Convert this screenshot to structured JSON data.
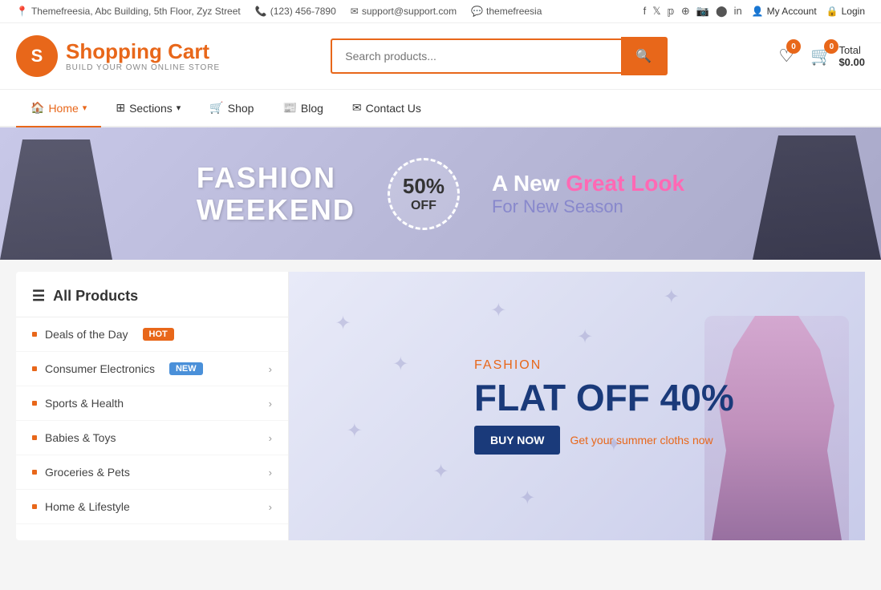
{
  "topbar": {
    "address": "Themefreesia, Abc Building, 5th Floor, Zyz Street",
    "phone": "(123) 456-7890",
    "email": "support@support.com",
    "skype": "themefreesia",
    "social_icons": [
      "facebook",
      "twitter",
      "pinterest",
      "dribbble",
      "instagram",
      "flickr",
      "linkedin"
    ],
    "my_account": "My Account",
    "login": "Login"
  },
  "header": {
    "logo_letter": "S",
    "logo_title": "Shopping Cart",
    "logo_subtitle": "BUILD YOUR OWN ONLINE STORE",
    "search_placeholder": "Search products...",
    "wishlist_count": "0",
    "cart_count": "0",
    "cart_total_label": "Total",
    "cart_total_value": "$0.00"
  },
  "nav": {
    "items": [
      {
        "label": "Home",
        "icon": "home",
        "has_dropdown": true,
        "active": true
      },
      {
        "label": "Sections",
        "icon": "grid",
        "has_dropdown": true,
        "active": false
      },
      {
        "label": "Shop",
        "icon": "cart",
        "has_dropdown": false,
        "active": false
      },
      {
        "label": "Blog",
        "icon": "blog",
        "has_dropdown": false,
        "active": false
      },
      {
        "label": "Contact Us",
        "icon": "envelope",
        "has_dropdown": false,
        "active": false
      }
    ]
  },
  "banner": {
    "text_line1": "FASHION",
    "text_line2": "WEEKEND",
    "percent": "50%",
    "off": "OFF",
    "headline_part1": "A New ",
    "headline_part2": "Great Look",
    "subheadline": "For New Season"
  },
  "sidebar": {
    "title": "All Products",
    "items": [
      {
        "label": "Deals of the Day",
        "badge": "HOT",
        "badge_type": "hot",
        "has_arrow": false
      },
      {
        "label": "Consumer Electronics",
        "badge": "NEW",
        "badge_type": "new",
        "has_arrow": true
      },
      {
        "label": "Sports & Health",
        "badge": null,
        "badge_type": null,
        "has_arrow": true
      },
      {
        "label": "Babies & Toys",
        "badge": null,
        "badge_type": null,
        "has_arrow": true
      },
      {
        "label": "Groceries & Pets",
        "badge": null,
        "badge_type": null,
        "has_arrow": true
      },
      {
        "label": "Home & Lifestyle",
        "badge": null,
        "badge_type": null,
        "has_arrow": true
      }
    ]
  },
  "promo": {
    "fashion_label": "FASHION",
    "flat_off": "FLAT OFF 40%",
    "buy_now": "BUY NOW",
    "tagline": "Get your summer cloths now"
  },
  "colors": {
    "accent": "#e8671a",
    "primary_blue": "#1a3a7a",
    "hot_badge": "#e8671a",
    "new_badge": "#4a90d9"
  }
}
